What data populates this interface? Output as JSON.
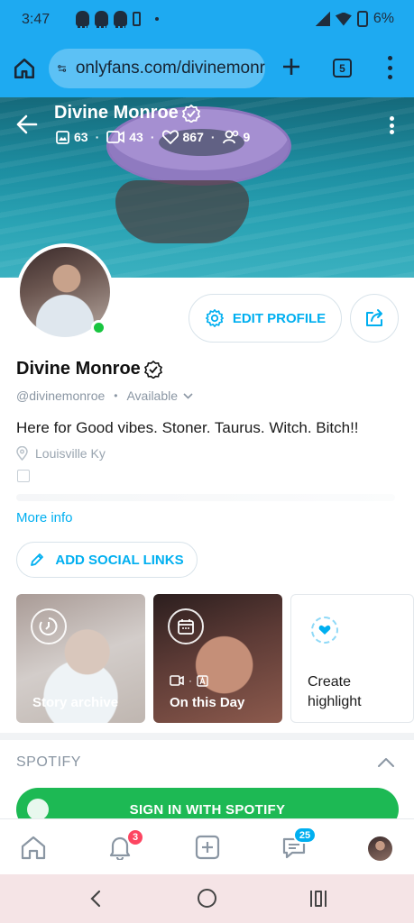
{
  "status_bar": {
    "time": "3:47",
    "battery": "6%",
    "left_icons": [
      "snapchat-icon",
      "snapchat-icon",
      "snapchat-icon",
      "battery-saver-icon",
      "dot-icon"
    ],
    "right_icons": [
      "signal-icon",
      "wifi-icon",
      "battery-icon"
    ]
  },
  "browser": {
    "url": "onlyfans.com/divinemonr",
    "tab_count": "5"
  },
  "cover": {
    "name": "Divine Monroe",
    "stats": {
      "photos": "63",
      "videos": "43",
      "likes": "867",
      "fans": "9"
    }
  },
  "profile": {
    "name": "Divine Monroe",
    "handle": "@divinemonroe",
    "availability": "Available",
    "bio": "Here for Good vibes. Stoner. Taurus. Witch. Bitch!!",
    "location": "Louisville Ky",
    "more_info": "More info",
    "online": true
  },
  "buttons": {
    "edit_profile": "EDIT PROFILE",
    "add_social_links": "ADD SOCIAL LINKS"
  },
  "highlights": [
    {
      "label": "Story archive",
      "icon": "clock-icon"
    },
    {
      "label": "On this Day",
      "icon": "calendar-icon"
    },
    {
      "label": "Create highlight",
      "icon": "heart-icon"
    }
  ],
  "spotify": {
    "title": "SPOTIFY",
    "button": "SIGN IN WITH SPOTIFY"
  },
  "bottom_nav": {
    "notifications_badge": "3",
    "messages_badge": "25"
  },
  "colors": {
    "browser_bar": "#1eaaf1",
    "accent": "#00aff0",
    "spotify_green": "#1db954",
    "online_green": "#18c540",
    "notification_red": "#fd4561"
  }
}
